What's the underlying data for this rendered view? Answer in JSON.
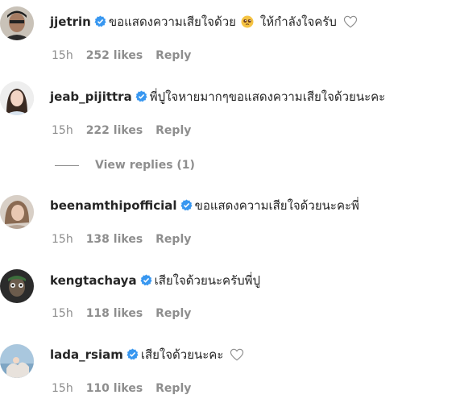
{
  "comments": [
    {
      "username": "jjetrin",
      "verified": true,
      "text": "ขอแสดงความเสียใจด้วย",
      "emoji": "pleading-face-emoji",
      "text_after": "ให้กำลังใจครับ",
      "has_heart": true,
      "time": "15h",
      "likes": "252 likes",
      "reply": "Reply"
    },
    {
      "username": "jeab_pijittra",
      "verified": true,
      "text": "พี่ปูใจหายมากๆขอแสดงความเสียใจด้วยนะคะ",
      "time": "15h",
      "likes": "222 likes",
      "reply": "Reply",
      "view_replies": "View replies (1)"
    },
    {
      "username": "beenamthipofficial",
      "verified": true,
      "text": "ขอแสดงความเสียใจด้วยนะคะพี่",
      "time": "15h",
      "likes": "138 likes",
      "reply": "Reply"
    },
    {
      "username": "kengtachaya",
      "verified": true,
      "text": "เสียใจด้วยนะครับพี่ปู",
      "time": "15h",
      "likes": "118 likes",
      "reply": "Reply"
    },
    {
      "username": "lada_rsiam",
      "verified": true,
      "text": "เสียใจด้วยนะคะ",
      "has_heart": true,
      "time": "15h",
      "likes": "110 likes",
      "reply": "Reply"
    }
  ],
  "colors": {
    "verified_blue": "#3897f0",
    "meta_gray": "#8e8e8e",
    "text": "#262626"
  }
}
